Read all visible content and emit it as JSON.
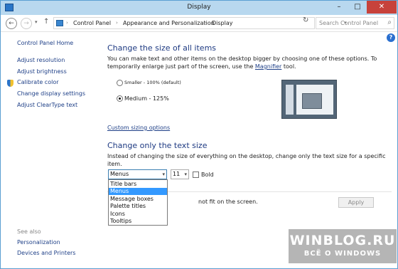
{
  "window": {
    "title": "Display"
  },
  "titlebar": {
    "minimize": "–",
    "maximize": "□",
    "close": "✕"
  },
  "address": {
    "back_glyph": "←",
    "forward_glyph": "→",
    "up_glyph": "↑",
    "crumbs": [
      "Control Panel",
      "Appearance and Personalization",
      "Display"
    ],
    "search_placeholder": "Search Control Panel"
  },
  "sidebar": {
    "home": "Control Panel Home",
    "links": [
      "Adjust resolution",
      "Adjust brightness",
      "Calibrate color",
      "Change display settings",
      "Adjust ClearType text"
    ],
    "see_also_title": "See also",
    "see_also": [
      "Personalization",
      "Devices and Printers"
    ]
  },
  "main": {
    "size_heading": "Change the size of all items",
    "size_desc_pre": "You can make text and other items on the desktop bigger by choosing one of these options. To temporarily enlarge just part of the screen, use the ",
    "size_desc_link": "Magnifier",
    "size_desc_post": " tool.",
    "option_small": "Smaller - 100% (default)",
    "option_medium": "Medium - 125%",
    "custom_link": "Custom sizing options",
    "text_heading": "Change only the text size",
    "text_desc": "Instead of changing the size of everything on the desktop, change only the text size for a specific item.",
    "item_select_value": "Menus",
    "size_select_value": "11",
    "bold_label": "Bold",
    "item_options": [
      "Title bars",
      "Menus",
      "Message boxes",
      "Palette titles",
      "Icons",
      "Tooltips"
    ],
    "selected_option_index": 1,
    "partial_note": "not fit on the screen.",
    "apply_label": "Apply"
  },
  "help": {
    "glyph": "?"
  },
  "watermark": {
    "line1": "WINBLOG.RU",
    "line2": "ВСЁ О WINDOWS"
  },
  "colors": {
    "accent": "#3399ff",
    "heading": "#1e3a82",
    "link": "#1e3f87",
    "titlebar": "#b8d8ef"
  },
  "icons": {
    "shield": "security-shield-icon",
    "search": "search-icon",
    "refresh": "refresh-icon"
  }
}
